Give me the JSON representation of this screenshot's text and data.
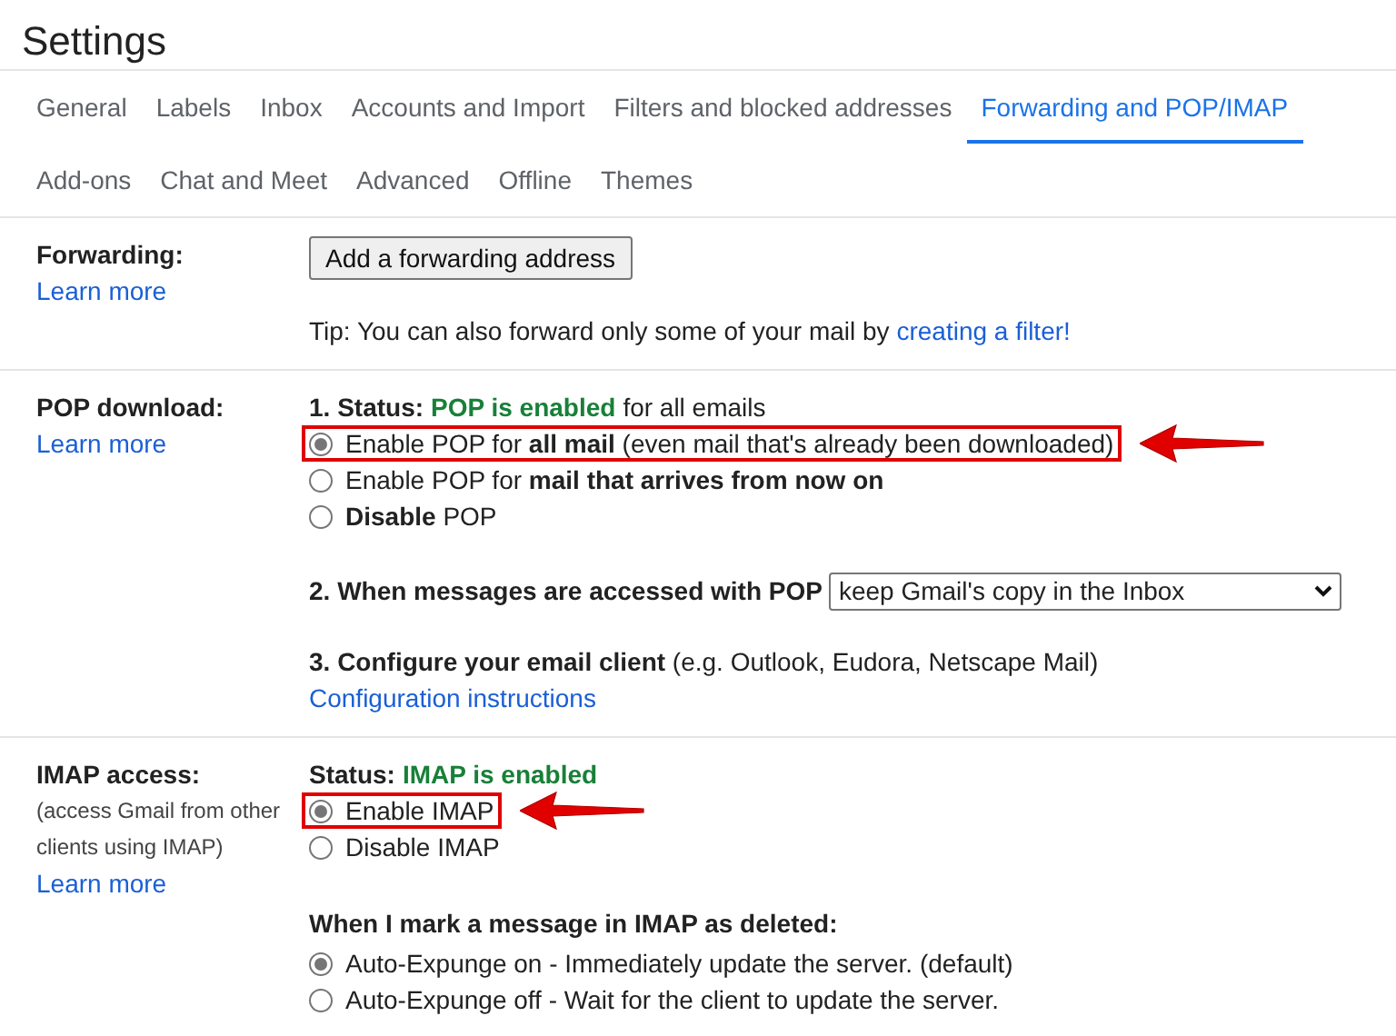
{
  "title": "Settings",
  "tabs": [
    {
      "label": "General",
      "selected": false
    },
    {
      "label": "Labels",
      "selected": false
    },
    {
      "label": "Inbox",
      "selected": false
    },
    {
      "label": "Accounts and Import",
      "selected": false
    },
    {
      "label": "Filters and blocked addresses",
      "selected": false
    },
    {
      "label": "Forwarding and POP/IMAP",
      "selected": true
    },
    {
      "label": "Add-ons",
      "selected": false
    },
    {
      "label": "Chat and Meet",
      "selected": false
    },
    {
      "label": "Advanced",
      "selected": false
    },
    {
      "label": "Offline",
      "selected": false
    },
    {
      "label": "Themes",
      "selected": false
    }
  ],
  "forwarding": {
    "heading": "Forwarding:",
    "learn_more": "Learn more",
    "button": "Add a forwarding address",
    "tip": "Tip: You can also forward only some of your mail by",
    "tip_link": "creating a filter!"
  },
  "pop": {
    "heading": "POP download:",
    "learn_more": "Learn more",
    "status": {
      "prefix": "1. Status:",
      "value": "POP is enabled",
      "suffix": "for all emails"
    },
    "options": [
      {
        "label": "Enable POP for **all mail** (even mail that's already been downloaded)",
        "selected": true,
        "annotated": true
      },
      {
        "label": "Enable POP for **mail that arrives from now on**",
        "selected": false,
        "annotated": false
      },
      {
        "label": "**Disable** POP",
        "selected": false,
        "annotated": false
      }
    ],
    "access_label": "2. When messages are accessed with POP",
    "access_value": "keep Gmail's copy in the Inbox",
    "configure": "**3. Configure your email client** (e.g. Outlook, Eudora, Netscape Mail)",
    "config_link": "Configuration instructions"
  },
  "imap": {
    "heading": "IMAP access:",
    "note": "(access Gmail from other clients using IMAP)",
    "learn_more": "Learn more",
    "status": {
      "prefix": "Status:",
      "value": "IMAP is enabled"
    },
    "options": [
      {
        "label": "Enable IMAP",
        "selected": true,
        "annotated": true
      },
      {
        "label": "Disable IMAP",
        "selected": false,
        "annotated": false
      }
    ],
    "delete_heading": "When I mark a message in IMAP as deleted:",
    "delete_options": [
      {
        "label": "Auto-Expunge on - Immediately update the server. (default)",
        "selected": true
      },
      {
        "label": "Auto-Expunge off - Wait for the client to update the server.",
        "selected": false
      }
    ]
  }
}
